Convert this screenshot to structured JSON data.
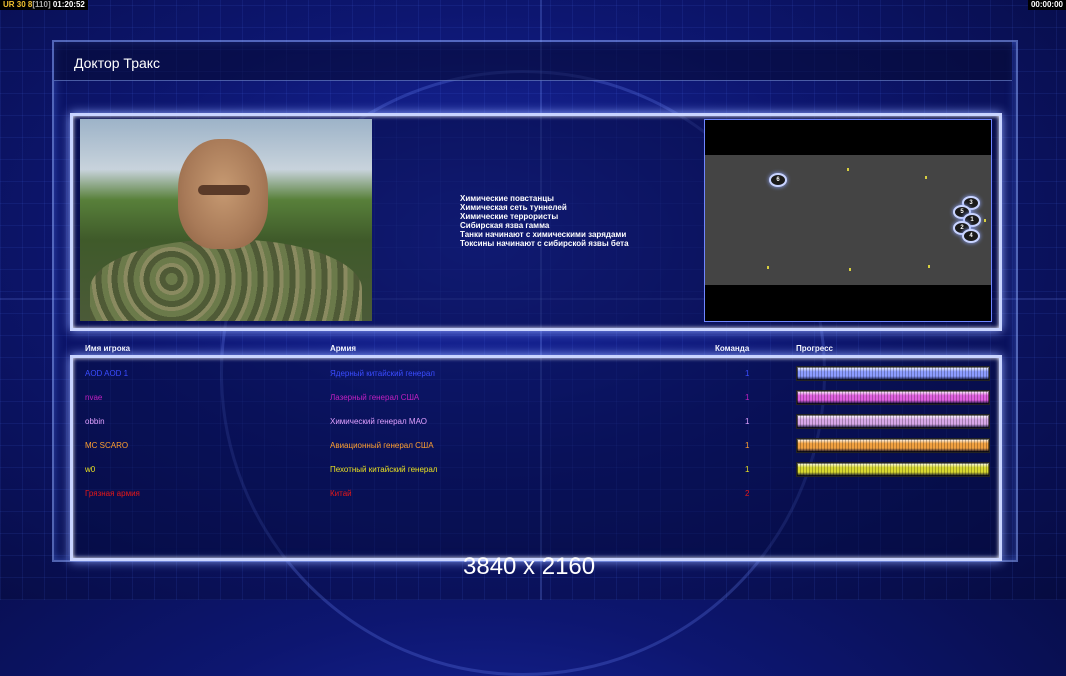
{
  "hud": {
    "left_a": "UR",
    "left_b": "30 8",
    "left_c": "[110]",
    "left_time": "01:20:52",
    "right_time": "00:00:00"
  },
  "page": {
    "title": "Доктор Тракс"
  },
  "specials": [
    "Химические повстанцы",
    "Химическая сеть туннелей",
    "Химические террористы",
    "Сибирская язва гамма",
    "Танки начинают с химическими зарядами",
    "Токсины начинают с сибирской язвы бета"
  ],
  "minimap": {
    "start_labels": [
      "6",
      "3",
      "5",
      "1",
      "2",
      "4"
    ]
  },
  "table": {
    "headers": {
      "player": "Имя игрока",
      "army": "Армия",
      "team": "Команда",
      "progress": "Прогресс"
    },
    "rows": [
      {
        "name": "AOD AOD 1",
        "army": "Ядерный китайский генерал",
        "team": "1",
        "color": "#3a4cff",
        "bar": "#8c9cff",
        "progress": 1.0
      },
      {
        "name": "nvae",
        "army": "Лазерный генерал США",
        "team": "1",
        "color": "#c020c0",
        "bar": "#e060e0",
        "progress": 1.0
      },
      {
        "name": "obbin",
        "army": "Химический генерал МАО",
        "team": "1",
        "color": "#e0a0ff",
        "bar": "#d8a8e8",
        "progress": 1.0
      },
      {
        "name": "MC SCARO",
        "army": "Авиационный генерал США",
        "team": "1",
        "color": "#ffa030",
        "bar": "#f0a040",
        "progress": 1.0
      },
      {
        "name": "w0",
        "army": "Пехотный китайский генерал",
        "team": "1",
        "color": "#e8e020",
        "bar": "#d8d830",
        "progress": 1.0
      },
      {
        "name": "Грязная армия",
        "army": "Китай",
        "team": "2",
        "color": "#e81818",
        "bar": "",
        "progress": 0
      }
    ]
  },
  "overlay": {
    "resolution": "3840 x 2160"
  }
}
